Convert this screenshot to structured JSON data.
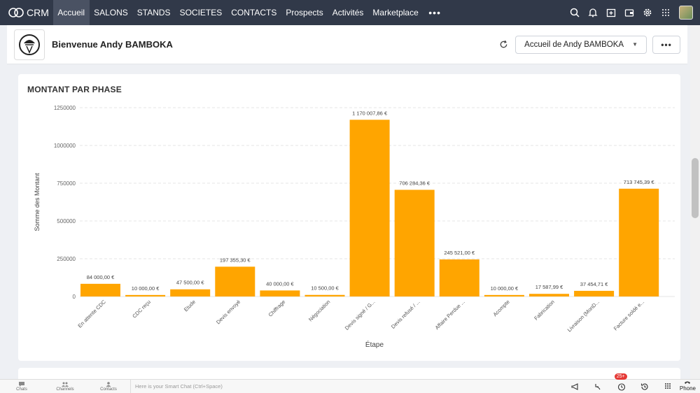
{
  "app": {
    "name": "CRM"
  },
  "nav": {
    "items": [
      {
        "label": "Accueil",
        "active": true
      },
      {
        "label": "SALONS"
      },
      {
        "label": "STANDS"
      },
      {
        "label": "SOCIETES"
      },
      {
        "label": "CONTACTS"
      },
      {
        "label": "Prospects"
      },
      {
        "label": "Activités"
      },
      {
        "label": "Marketplace"
      }
    ],
    "more": "•••",
    "right_icons": [
      "search-icon",
      "bell-icon",
      "add-calendar-icon",
      "wallet-icon",
      "gear-icon",
      "apps-grid-icon"
    ]
  },
  "header": {
    "welcome": "Bienvenue Andy BAMBOKA",
    "dropdown": "Accueil de Andy BAMBOKA",
    "more": "•••"
  },
  "chart_title": "MONTANT PAR PHASE",
  "chart_data": {
    "type": "bar",
    "title": "MONTANT PAR PHASE",
    "xlabel": "Étape",
    "ylabel": "Somme des Montant",
    "ylim": [
      0,
      1250000
    ],
    "yticks": [
      0,
      250000,
      500000,
      750000,
      1000000,
      1250000
    ],
    "ytick_labels": [
      "0",
      "250000",
      "500000",
      "750000",
      "1000000",
      "1250000"
    ],
    "categories": [
      "En attente CDC",
      "CDC reçu",
      "Etude",
      "Devis envoyé",
      "Chiffrage",
      "Négociation",
      "Devis signé / G...",
      "Devis refusé / ...",
      "Affaire Perdue ...",
      "Acompte",
      "Fabrication",
      "Livraison (MonD...",
      "Facture soldé e..."
    ],
    "values": [
      84000,
      10000,
      47500,
      197355.3,
      40000,
      10500,
      1170007.86,
      706284.36,
      245521.0,
      10000,
      17587.99,
      37454.71,
      713745.39
    ],
    "data_labels": [
      "84 000,00 €",
      "10 000,00 €",
      "47 500,00 €",
      "197 355,30 €",
      "40 000,00 €",
      "10 500,00 €",
      "1 170 007,86 €",
      "706 284,36 €",
      "245 521,00 €",
      "10 000,00 €",
      "17 587,99 €",
      "37 454,71 €",
      "713 745,39 €"
    ],
    "color": "#FFA500",
    "grid": true
  },
  "bottom": {
    "items": [
      {
        "label": "Chats",
        "icon": "chat-icon"
      },
      {
        "label": "Channels",
        "icon": "channels-icon"
      },
      {
        "label": "Contacts",
        "icon": "contacts-icon"
      }
    ],
    "smartchat_placeholder": "Here is your Smart Chat (Ctrl+Space)",
    "badge": "25+",
    "phone_label": "Phone"
  }
}
